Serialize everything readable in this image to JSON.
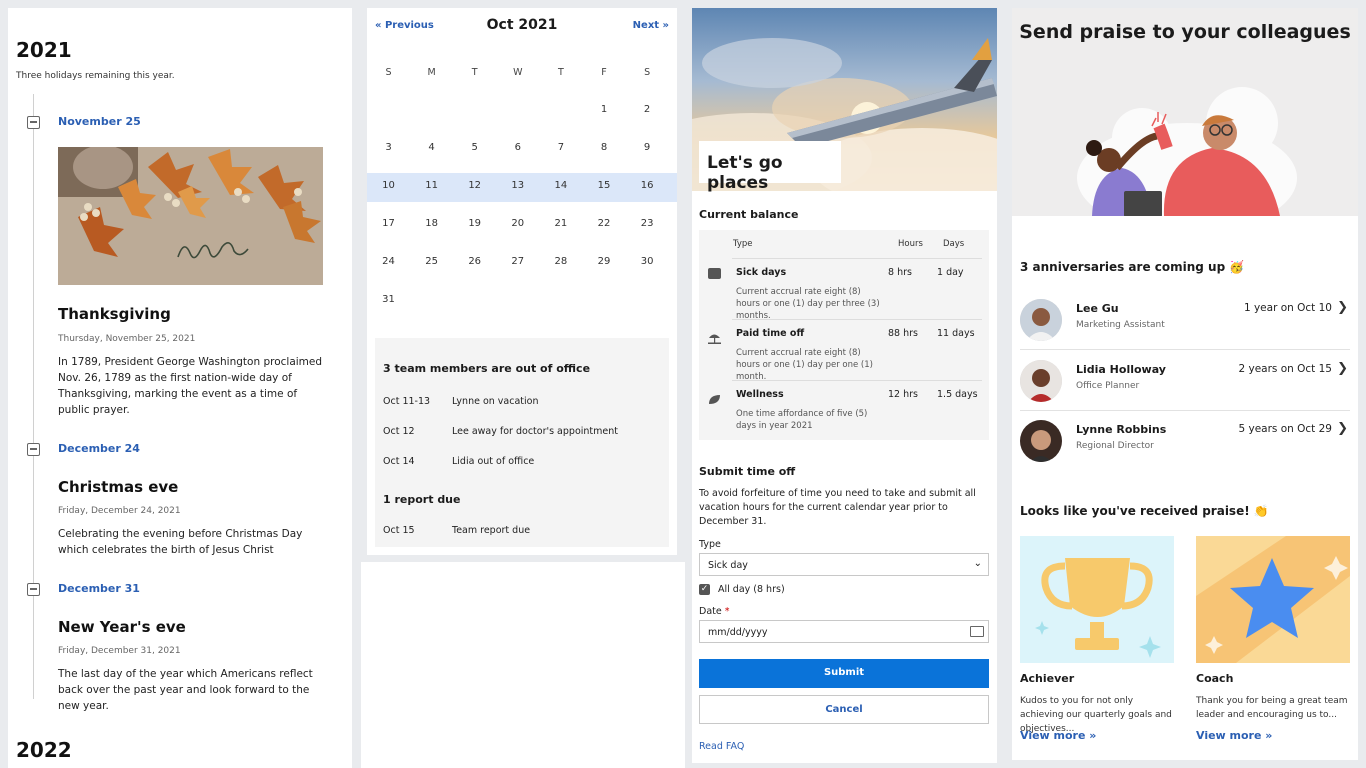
{
  "holidays": {
    "year_current": "2021",
    "subtitle": "Three holidays remaining this year.",
    "year_next": "2022",
    "items": [
      {
        "date": "November 25",
        "name": "Thanksgiving",
        "when": "Thursday, November 25, 2021",
        "desc": "In 1789, President George Washington proclaimed Nov. 26, 1789 as the first nation-wide day of Thanksgiving, marking the event as a time of public prayer."
      },
      {
        "date": "December 24",
        "name": "Christmas eve",
        "when": "Friday, December 24, 2021",
        "desc": "Celebrating the evening before Christmas Day which celebrates the birth of Jesus Christ"
      },
      {
        "date": "December 31",
        "name": "New Year's eve",
        "when": "Friday, December 31, 2021",
        "desc": "The last day of the year which Americans reflect back over the past year and look forward to the new year."
      }
    ],
    "image_text": "give thanks"
  },
  "calendar": {
    "prev": "« Previous",
    "next": "Next »",
    "title": "Oct 2021",
    "dow": [
      "S",
      "M",
      "T",
      "W",
      "T",
      "F",
      "S"
    ],
    "weeks": [
      [
        "",
        "",
        "",
        "",
        "",
        "1",
        "2"
      ],
      [
        "3",
        "4",
        "5",
        "6",
        "7",
        "8",
        "9"
      ],
      [
        "10",
        "11",
        "12",
        "13",
        "14",
        "15",
        "16"
      ],
      [
        "17",
        "18",
        "19",
        "20",
        "21",
        "22",
        "23"
      ],
      [
        "24",
        "25",
        "26",
        "27",
        "28",
        "29",
        "30"
      ],
      [
        "31",
        "",
        "",
        "",
        "",
        "",
        ""
      ]
    ],
    "highlight_week": 2,
    "ooo_heading": "3 team members are out of office",
    "ooo": [
      {
        "date": "Oct 11-13",
        "text": "Lynne on vacation"
      },
      {
        "date": "Oct 12",
        "text": "Lee away for doctor's appointment"
      },
      {
        "date": "Oct 14",
        "text": "Lidia out of office"
      }
    ],
    "report_heading": "1 report due",
    "reports": [
      {
        "date": "Oct 15",
        "text": "Team report due"
      }
    ]
  },
  "timeoff": {
    "hero_label": "Let's go places",
    "balance_heading": "Current balance",
    "cols": {
      "type": "Type",
      "hours": "Hours",
      "days": "Days"
    },
    "rows": [
      {
        "icon": "briefcase-icon",
        "name": "Sick days",
        "hours": "8 hrs",
        "days": "1 day",
        "desc": "Current accrual rate eight (8) hours or one (1) day per three (3) months."
      },
      {
        "icon": "beach-umbrella-icon",
        "name": "Paid time off",
        "hours": "88 hrs",
        "days": "11 days",
        "desc": "Current accrual rate eight (8) hours or one (1) day per one (1) month."
      },
      {
        "icon": "leaf-icon",
        "name": "Wellness",
        "hours": "12 hrs",
        "days": "1.5 days",
        "desc": "One time affordance of five (5) days in year 2021"
      }
    ],
    "submit_heading": "Submit time off",
    "submit_desc": "To avoid forfeiture of time you need to take and submit all vacation hours for the current calendar year prior to December 31.",
    "type_label": "Type",
    "type_value": "Sick day",
    "allday_label": "All day (8 hrs)",
    "allday_checked": true,
    "date_label": "Date",
    "date_required": "*",
    "date_placeholder": "mm/dd/yyyy",
    "submit_btn": "Submit",
    "cancel_btn": "Cancel",
    "faq": "Read FAQ",
    "accent": "#0a73d9"
  },
  "praise": {
    "title": "Send praise to your colleagues",
    "ann_heading": "3 anniversaries are coming up",
    "people": [
      {
        "name": "Lee Gu",
        "role": "Marketing Assistant",
        "when": "1 year on Oct 10"
      },
      {
        "name": "Lidia Holloway",
        "role": "Office Planner",
        "when": "2 years on Oct 15"
      },
      {
        "name": "Lynne Robbins",
        "role": "Regional Director",
        "when": "5 years on Oct 29"
      }
    ],
    "received_heading": "Looks like you've received praise!",
    "badges": [
      {
        "name": "Achiever",
        "desc": "Kudos to you for not only achieving our quarterly goals and objectives...",
        "link": "View more »"
      },
      {
        "name": "Coach",
        "desc": "Thank you for being a great team leader and encouraging us to...",
        "link": "View more »"
      }
    ]
  }
}
